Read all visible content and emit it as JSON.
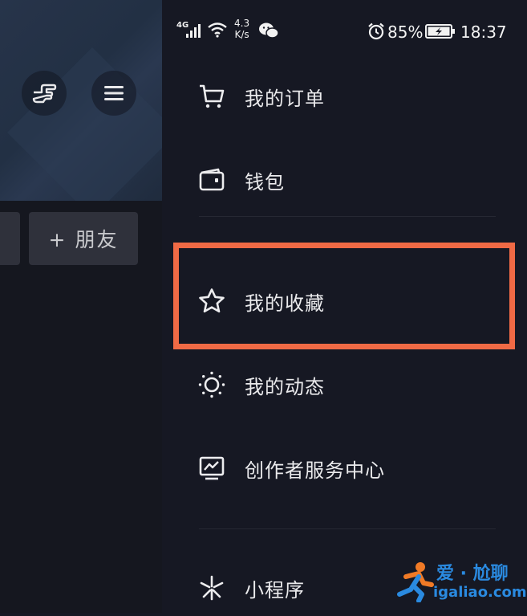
{
  "status_bar": {
    "signal_label": "4G",
    "net_speed_value": "4.3",
    "net_speed_unit": "K/s",
    "battery": "85%",
    "time": "18:37"
  },
  "profile": {
    "add_friend_label": "+ 朋友"
  },
  "drawer": {
    "items": [
      {
        "label": "我的订单",
        "icon": "cart-icon"
      },
      {
        "label": "钱包",
        "icon": "wallet-icon"
      },
      {
        "label": "我的收藏",
        "icon": "star-icon"
      },
      {
        "label": "我的动态",
        "icon": "sun-icon"
      },
      {
        "label": "创作者服务中心",
        "icon": "chart-monitor-icon"
      },
      {
        "label": "小程序",
        "icon": "asterisk-icon"
      }
    ]
  },
  "highlight": {
    "target": "我的收藏",
    "color": "#f06a45"
  },
  "watermark": {
    "line1": "爱 · 尬聊",
    "line2": "igaliao.com"
  }
}
